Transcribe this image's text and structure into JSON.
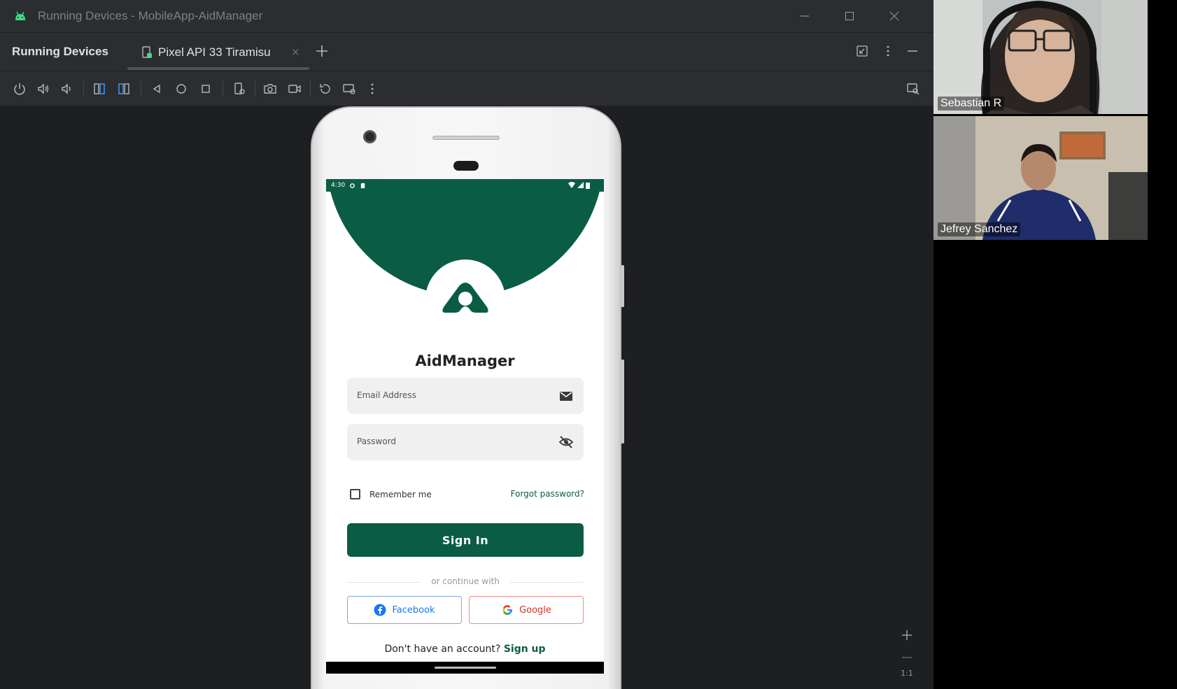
{
  "window": {
    "title": "Running Devices - MobileApp-AidManager"
  },
  "tool_window": {
    "title": "Running Devices",
    "tab_label": "Pixel API 33 Tiramisu",
    "tab_close": "×"
  },
  "app": {
    "status_time": "4:30",
    "name": "AidManager",
    "email_placeholder": "Email Address",
    "password_placeholder": "Password",
    "remember_label": "Remember me",
    "forgot_label": "Forgot password?",
    "signin_label": "Sign In",
    "divider_label": "or continue with",
    "facebook_label": "Facebook",
    "google_label": "Google",
    "signup_prompt": "Don't have an account?",
    "signup_link": "Sign up",
    "brand_color": "#0b5c44"
  },
  "zoom": {
    "ratio_label": "1:1"
  },
  "participants": [
    {
      "name": "Sebastian R"
    },
    {
      "name": "Jefrey Sanchez"
    }
  ]
}
